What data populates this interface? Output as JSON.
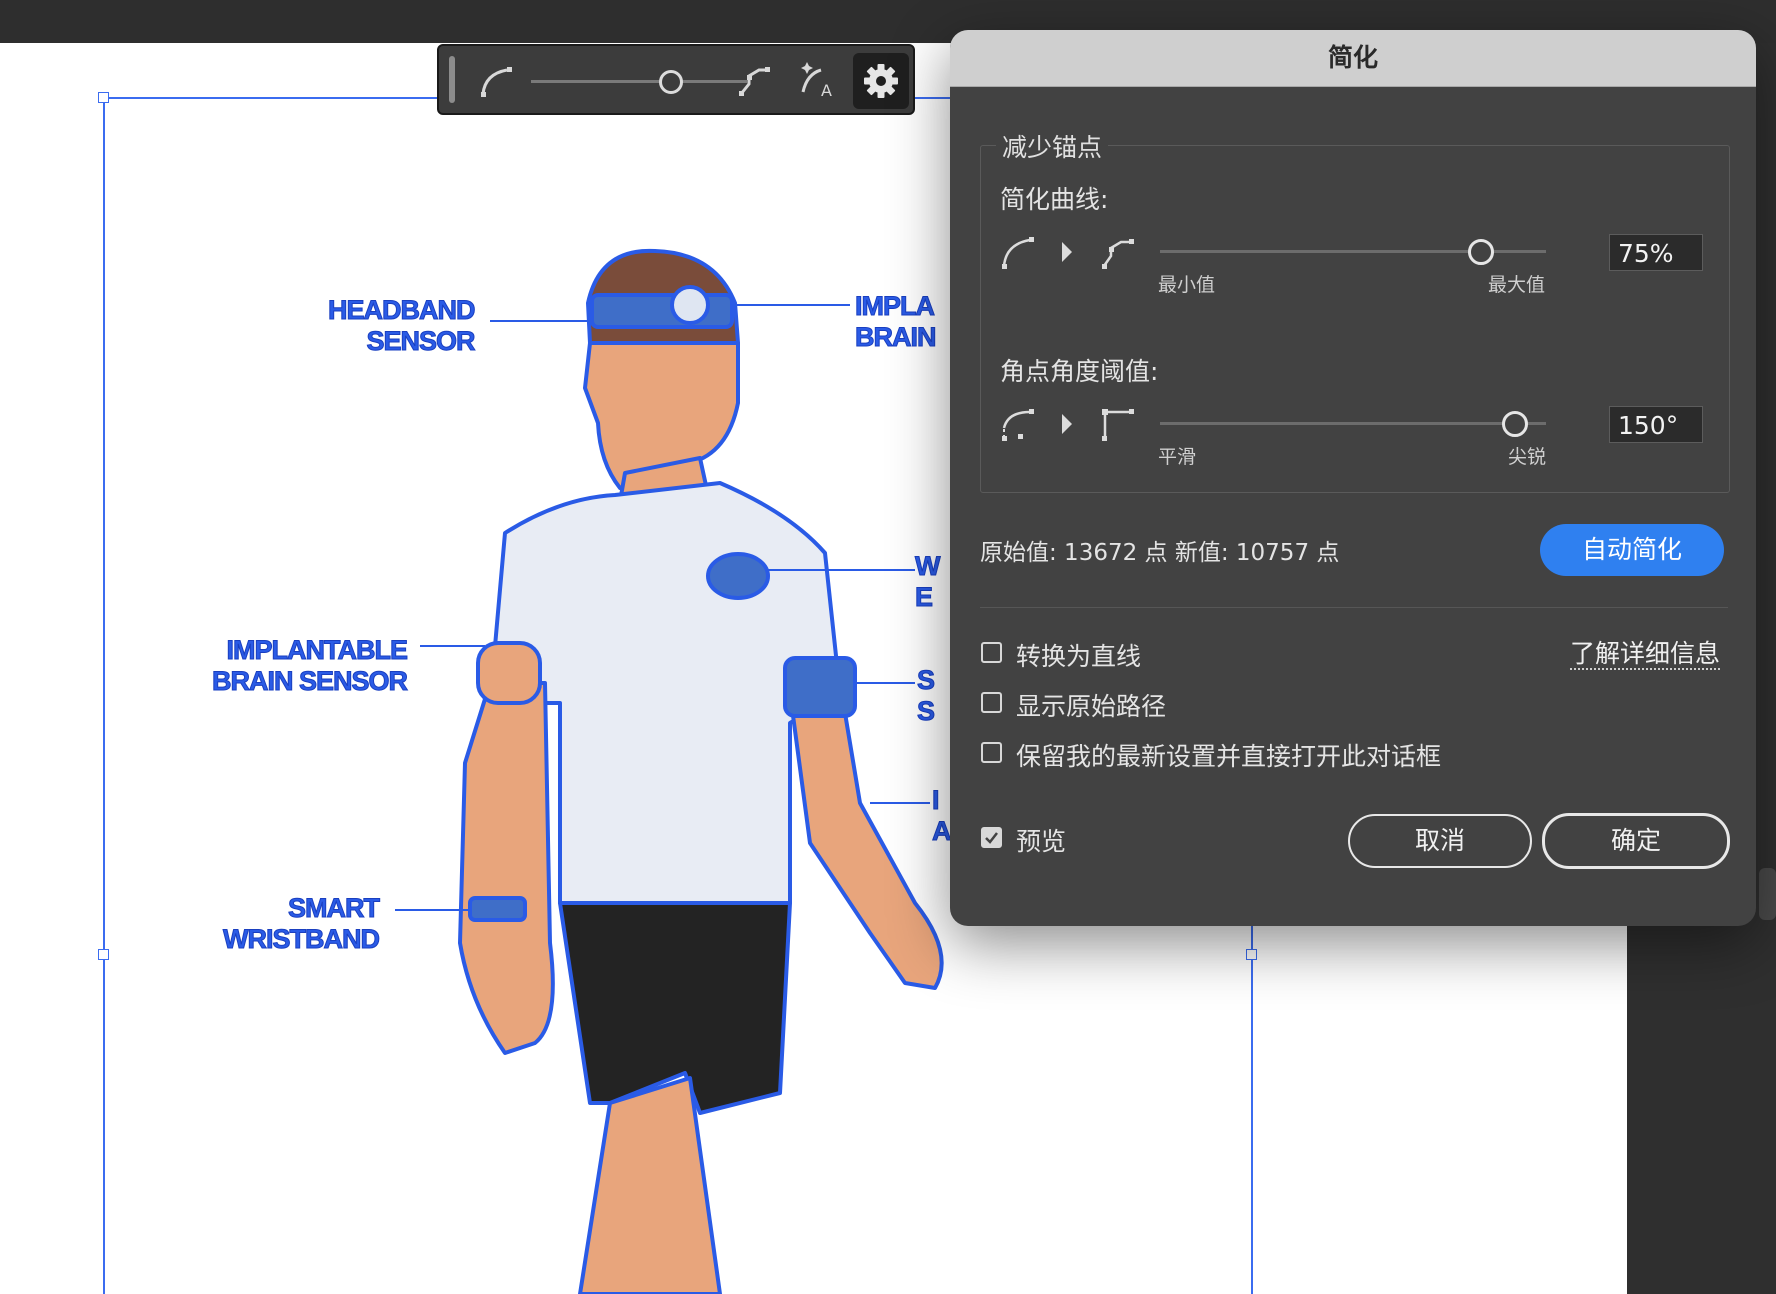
{
  "dialog": {
    "title": "简化",
    "group_label": "减少锚点",
    "simplify_curve": {
      "label": "简化曲线:",
      "value": "75%",
      "min_label": "最小值",
      "max_label": "最大值",
      "level": 0.75
    },
    "corner_threshold": {
      "label": "角点角度阈值:",
      "value": "150°",
      "min_label": "平滑",
      "max_label": "尖锐",
      "level": 0.83
    },
    "stats_text": "原始值: 13672 点 新值: 10757 点",
    "auto_simplify_label": "自动简化",
    "options": {
      "convert_to_lines": "转换为直线",
      "show_original_path": "显示原始路径",
      "keep_settings": "保留我的最新设置并直接打开此对话框",
      "preview": "预览"
    },
    "learn_more": "了解详细信息",
    "cancel_label": "取消",
    "ok_label": "确定",
    "primary_color": "#2f80f0"
  },
  "toolbar": {
    "icons": [
      "smooth-curve-icon",
      "simplify-slider",
      "corner-points-icon",
      "auto-simplify-icon",
      "gear-icon"
    ],
    "slider_level": 0.75
  },
  "artwork": {
    "labels": {
      "headband": "HEADBAND\nSENSOR",
      "implant_left": "IMPLANTABLE\nBRAIN SENSOR",
      "wristband": "SMART\nWRISTBAND",
      "implant_right": "IMPLA\nBRAIN",
      "right_top": "W\nE",
      "right_mid": "S\nS",
      "right_low": "I\nA"
    }
  }
}
